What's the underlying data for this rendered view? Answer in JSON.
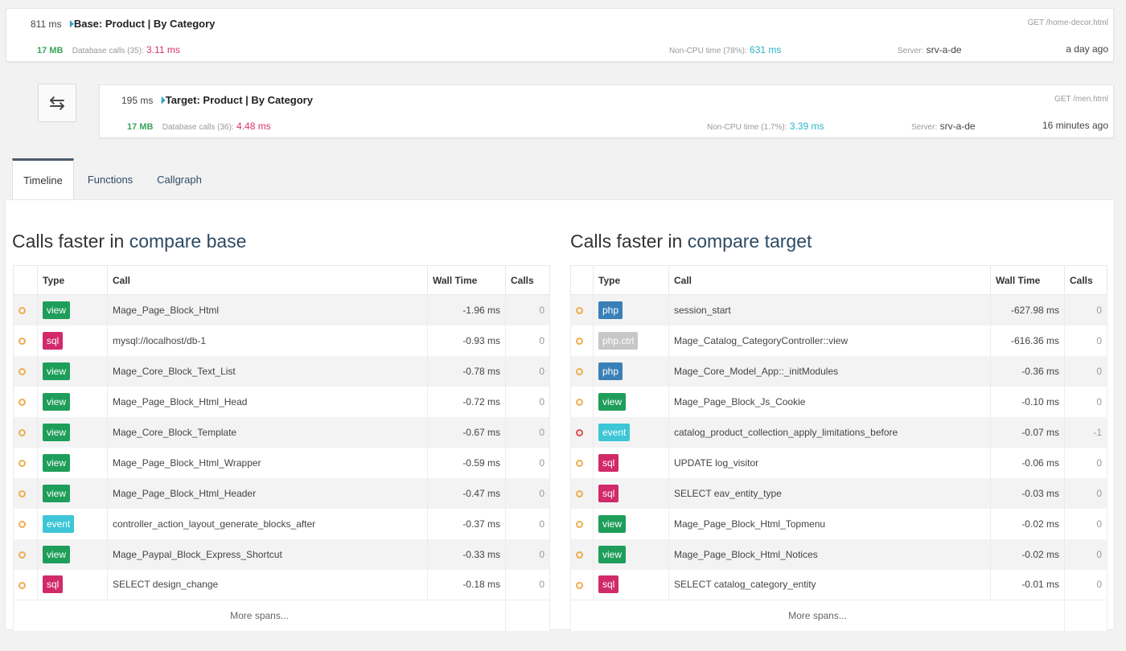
{
  "base": {
    "time": "811 ms",
    "pin_icon": "pin-icon",
    "title": "Base: Product | By Category",
    "request": "GET /home-decor.html",
    "memory": "17 MB",
    "db_label": "Database calls (35):",
    "db_value": "3.11 ms",
    "cpu_label": "Non-CPU time (78%):",
    "cpu_value": "631 ms",
    "server_label": "Server:",
    "server_value": "srv-a-de",
    "when": "a day ago"
  },
  "target": {
    "time": "195 ms",
    "pin_icon": "pin-icon",
    "title": "Target: Product | By Category",
    "request": "GET /men.html",
    "memory": "17 MB",
    "db_label": "Database calls (36):",
    "db_value": "4.48 ms",
    "cpu_label": "Non-CPU time (1.7%):",
    "cpu_value": "3.39 ms",
    "server_label": "Server:",
    "server_value": "srv-a-de",
    "when": "16 minutes ago"
  },
  "swap_icon": "swap-arrows-icon",
  "tabs": [
    {
      "label": "Timeline",
      "active": true
    },
    {
      "label": "Functions",
      "active": false
    },
    {
      "label": "Callgraph",
      "active": false
    }
  ],
  "colors": {
    "view": "#1e9e5a",
    "sql": "#d12a6a",
    "event": "#3cc6d6",
    "php": "#3a80b8",
    "phpctrl": "#c7c7c7"
  },
  "left": {
    "title_prefix": "Calls faster in ",
    "title_accent": "compare base",
    "headers": {
      "type": "Type",
      "call": "Call",
      "wall": "Wall Time",
      "calls": "Calls"
    },
    "rows": [
      {
        "status": "neutral",
        "type": "view",
        "call": "Mage_Page_Block_Html",
        "wall": "-1.96 ms",
        "calls": "0"
      },
      {
        "status": "neutral",
        "type": "sql",
        "call": "mysql://localhost/db-1",
        "wall": "-0.93 ms",
        "calls": "0"
      },
      {
        "status": "neutral",
        "type": "view",
        "call": "Mage_Core_Block_Text_List",
        "wall": "-0.78 ms",
        "calls": "0"
      },
      {
        "status": "neutral",
        "type": "view",
        "call": "Mage_Page_Block_Html_Head",
        "wall": "-0.72 ms",
        "calls": "0"
      },
      {
        "status": "neutral",
        "type": "view",
        "call": "Mage_Core_Block_Template",
        "wall": "-0.67 ms",
        "calls": "0"
      },
      {
        "status": "neutral",
        "type": "view",
        "call": "Mage_Page_Block_Html_Wrapper",
        "wall": "-0.59 ms",
        "calls": "0"
      },
      {
        "status": "neutral",
        "type": "view",
        "call": "Mage_Page_Block_Html_Header",
        "wall": "-0.47 ms",
        "calls": "0"
      },
      {
        "status": "neutral",
        "type": "event",
        "call": "controller_action_layout_generate_blocks_after",
        "wall": "-0.37 ms",
        "calls": "0"
      },
      {
        "status": "neutral",
        "type": "view",
        "call": "Mage_Paypal_Block_Express_Shortcut",
        "wall": "-0.33 ms",
        "calls": "0"
      },
      {
        "status": "neutral",
        "type": "sql",
        "call": "SELECT design_change",
        "wall": "-0.18 ms",
        "calls": "0"
      }
    ],
    "more": "More spans..."
  },
  "right": {
    "title_prefix": "Calls faster in ",
    "title_accent": "compare target",
    "headers": {
      "type": "Type",
      "call": "Call",
      "wall": "Wall Time",
      "calls": "Calls"
    },
    "rows": [
      {
        "status": "neutral",
        "type": "php",
        "call": "session_start",
        "wall": "-627.98 ms",
        "calls": "0"
      },
      {
        "status": "neutral",
        "type": "php.ctrl",
        "call": "Mage_Catalog_CategoryController::view",
        "wall": "-616.36 ms",
        "calls": "0"
      },
      {
        "status": "neutral",
        "type": "php",
        "call": "Mage_Core_Model_App::_initModules",
        "wall": "-0.36 ms",
        "calls": "0"
      },
      {
        "status": "neutral",
        "type": "view",
        "call": "Mage_Page_Block_Js_Cookie",
        "wall": "-0.10 ms",
        "calls": "0"
      },
      {
        "status": "error",
        "type": "event",
        "call": "catalog_product_collection_apply_limitations_before",
        "wall": "-0.07 ms",
        "calls": "-1"
      },
      {
        "status": "neutral",
        "type": "sql",
        "call": "UPDATE log_visitor",
        "wall": "-0.06 ms",
        "calls": "0"
      },
      {
        "status": "neutral",
        "type": "sql",
        "call": "SELECT eav_entity_type",
        "wall": "-0.03 ms",
        "calls": "0"
      },
      {
        "status": "neutral",
        "type": "view",
        "call": "Mage_Page_Block_Html_Topmenu",
        "wall": "-0.02 ms",
        "calls": "0"
      },
      {
        "status": "neutral",
        "type": "view",
        "call": "Mage_Page_Block_Html_Notices",
        "wall": "-0.02 ms",
        "calls": "0"
      },
      {
        "status": "neutral",
        "type": "sql",
        "call": "SELECT catalog_category_entity",
        "wall": "-0.01 ms",
        "calls": "0"
      }
    ],
    "more": "More spans..."
  }
}
